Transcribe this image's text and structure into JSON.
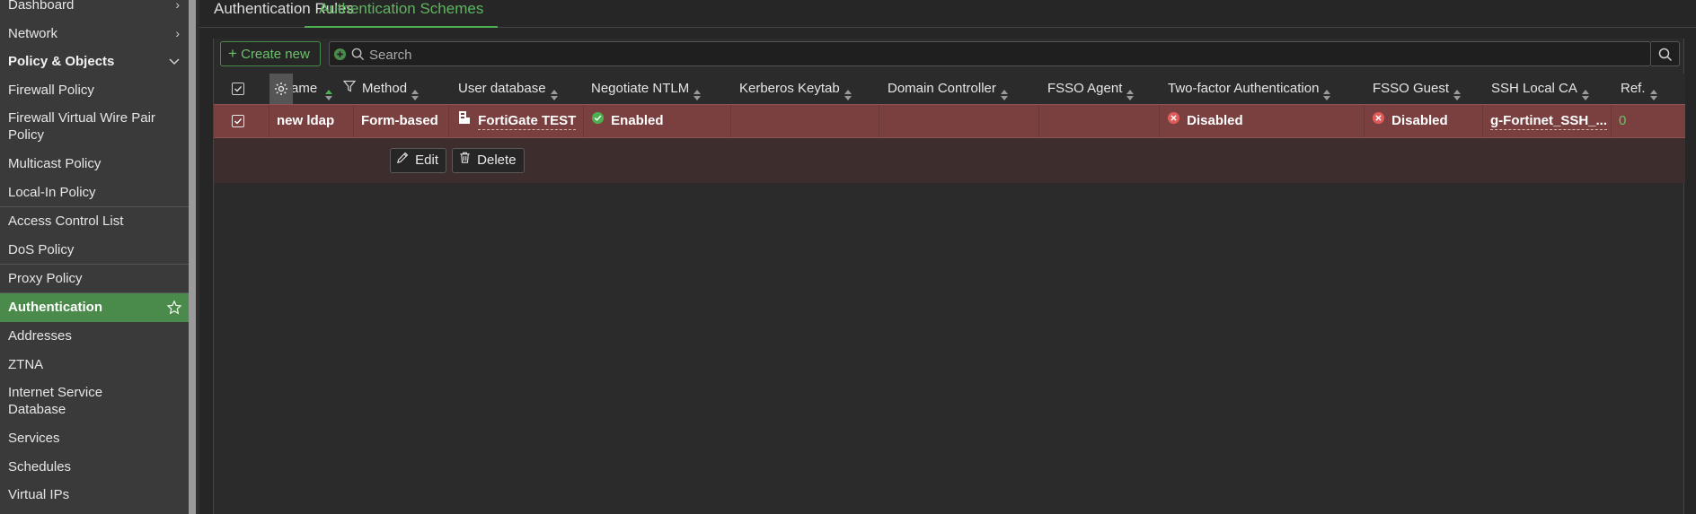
{
  "sidebar": {
    "items": [
      {
        "label": "Dashboard",
        "has_chevron": true
      },
      {
        "label": "Network",
        "has_chevron": true
      },
      {
        "label": "Policy & Objects",
        "section": true,
        "expanded": true
      },
      {
        "label": "Firewall Policy"
      },
      {
        "label": "Firewall Virtual Wire Pair Policy"
      },
      {
        "label": "Multicast Policy"
      },
      {
        "label": "Local-In Policy"
      },
      {
        "label": "Access Control List"
      },
      {
        "label": "DoS Policy"
      },
      {
        "label": "Proxy Policy"
      },
      {
        "label": "Authentication",
        "active": true
      },
      {
        "label": "Addresses"
      },
      {
        "label": "ZTNA"
      },
      {
        "label": "Internet Service Database"
      },
      {
        "label": "Services"
      },
      {
        "label": "Schedules"
      },
      {
        "label": "Virtual IPs"
      }
    ]
  },
  "tabs": [
    {
      "label": "Authentication Rules",
      "active": false
    },
    {
      "label": "Authentication Schemes",
      "active": true
    }
  ],
  "toolbar": {
    "create_label": "Create new",
    "search_placeholder": "Search"
  },
  "table": {
    "columns": [
      "Name",
      "Method",
      "User database",
      "Negotiate NTLM",
      "Kerberos Keytab",
      "Domain Controller",
      "FSSO Agent",
      "Two-factor Authentication",
      "FSSO Guest",
      "SSH Local CA",
      "Ref."
    ],
    "header_visible": {
      "name": "ame"
    },
    "rows": [
      {
        "name": "new ldap",
        "method": "Form-based",
        "user_database": "FortiGate TEST",
        "negotiate_ntlm": "Enabled",
        "kerberos_keytab": "",
        "domain_controller": "",
        "fsso_agent": "",
        "two_factor": "Disabled",
        "fsso_guest": "Disabled",
        "ssh_local_ca": "g-Fortinet_SSH_...",
        "ref": "0"
      }
    ],
    "row_actions": {
      "edit_label": "Edit",
      "delete_label": "Delete"
    }
  },
  "colors": {
    "accent": "#4caf50",
    "active_nav": "#4a8a4a",
    "selected_row": "#7a4040",
    "enabled": "#4caf50",
    "disabled": "#e05a5a"
  }
}
